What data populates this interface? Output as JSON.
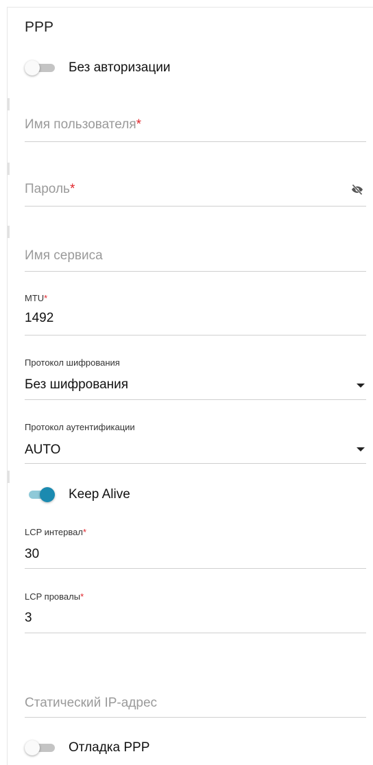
{
  "section_title": "PPP",
  "no_auth_toggle": {
    "label": "Без авторизации",
    "on": false
  },
  "username": {
    "placeholder": "Имя пользователя",
    "required_mark": "*"
  },
  "password": {
    "placeholder": "Пароль",
    "required_mark": "*",
    "icon": "eye-off-icon"
  },
  "service_name": {
    "placeholder": "Имя сервиса"
  },
  "mtu": {
    "label": "MTU",
    "required_mark": "*",
    "value": "1492"
  },
  "encryption": {
    "label": "Протокол шифрования",
    "value": "Без шифрования"
  },
  "auth_protocol": {
    "label": "Протокол аутентификации",
    "value": "AUTO"
  },
  "keep_alive_toggle": {
    "label": "Keep Alive",
    "on": true
  },
  "lcp_interval": {
    "label": "LCP интервал",
    "required_mark": "*",
    "value": "30"
  },
  "lcp_fails": {
    "label": "LCP провалы",
    "required_mark": "*",
    "value": "3"
  },
  "static_ip": {
    "placeholder": "Статический IP-адрес"
  },
  "debug_toggle": {
    "label": "Отладка PPP",
    "on": false
  },
  "colors": {
    "accent": "#1b8ab0",
    "accent_track": "#8fc9d8",
    "required": "#e0252b"
  }
}
